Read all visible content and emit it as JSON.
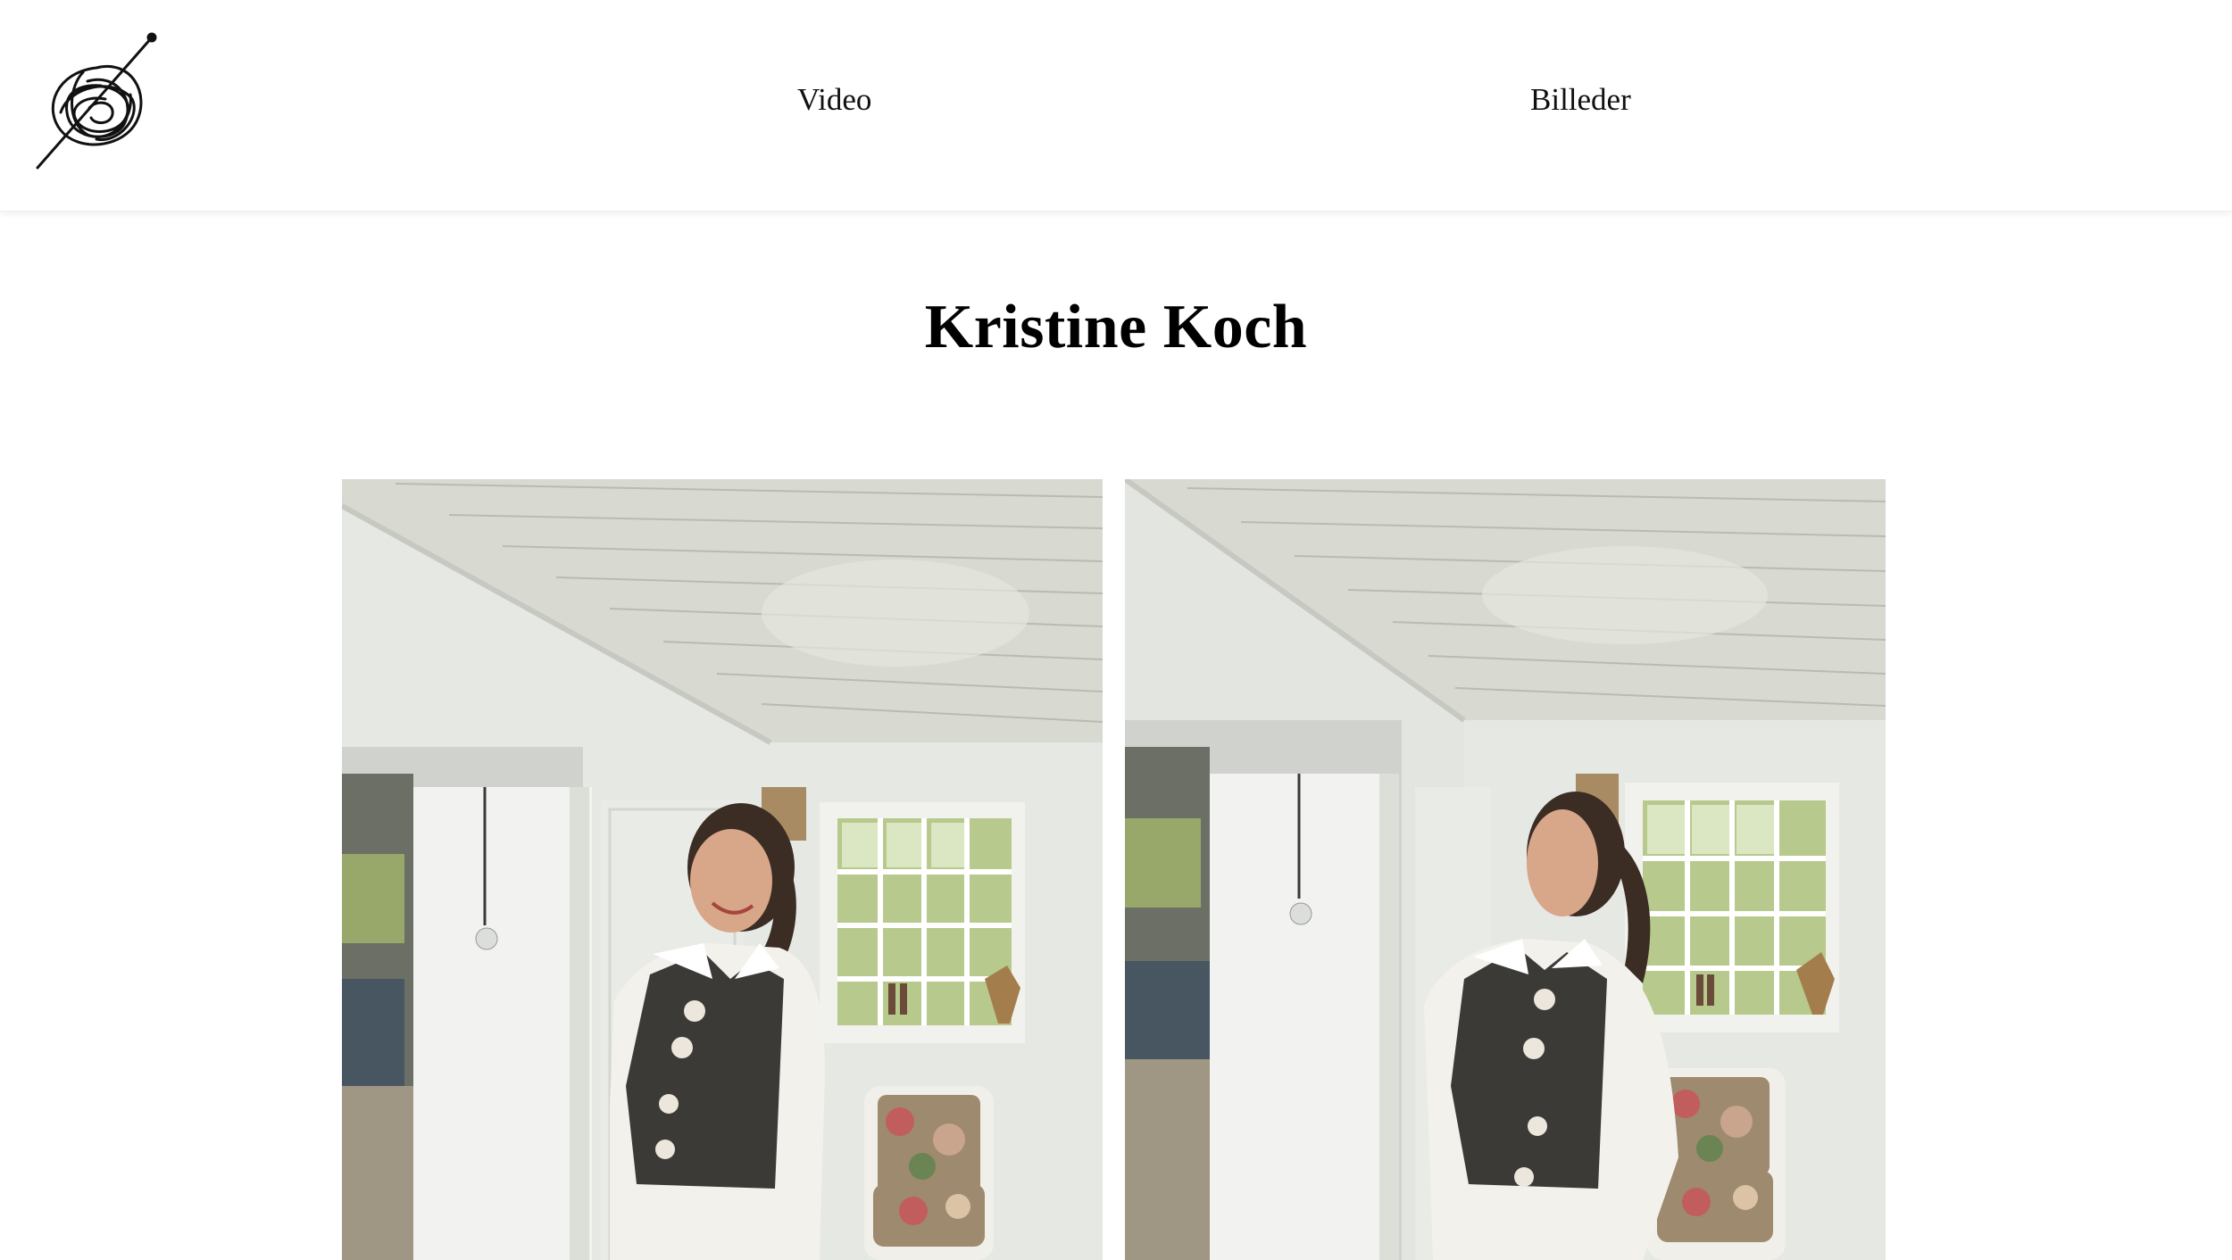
{
  "nav": {
    "logo_icon": "yarn-ball-with-needle-icon",
    "items": [
      {
        "label": "Video"
      },
      {
        "label": "Billeder"
      }
    ]
  },
  "page": {
    "title": "Kristine Koch"
  },
  "gallery": {
    "images": [
      {
        "name": "photo-1",
        "description_icon": "photo"
      },
      {
        "name": "photo-2",
        "description_icon": "photo"
      }
    ]
  },
  "colors": {
    "background": "#ffffff",
    "text": "#111111",
    "wall": "#e4e6e2",
    "ceiling": "#d9dbd3",
    "vest": "#3c3a37",
    "shirt": "#f3f1ec"
  }
}
